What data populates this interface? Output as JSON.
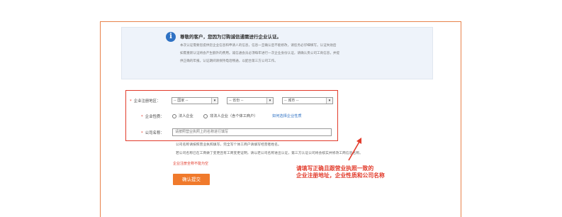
{
  "notice": {
    "title": "尊敬的客户，您因为订购诚信通需进行企业认证。",
    "lines": [
      "本次认证需要您提供您企业信息和申请人的信息，信息一旦确认后不能修改，请您务必仔细填写。认证失败后",
      "如需重新认证将会产生额外的费用。诚信通会员必须每年进行一次企业身份认证，请确认贵公司工商信息，并提",
      "供正确的年报。认证期间请保持电话畅通，以配合第三方公司工作。"
    ]
  },
  "form": {
    "address_label": "企业注册地区：",
    "country_select": "-- 国家 --",
    "province_select": "-- 省份 --",
    "city_select": "-- 城市 --",
    "nature_label": "企业性质：",
    "radio_legal": "法人企业",
    "radio_nonlegal": "非法人企业（含个体工商户）",
    "nature_link": "如何选择企业性质",
    "name_label": "公司名称：",
    "name_placeholder": "请按照营业执照上的名称进行填写",
    "help_1": "公司名称请按照营业执照填写，完全写个体工商户请填写经营者姓名。",
    "help_2": "若公司名称已在工商做了变更且有工商变更证明，请以老公司名称进出认证，第三方认证公司将会核实并修改工商信息名称。",
    "error": "企业注册全称不能为空",
    "submit": "确认提交"
  },
  "callout": {
    "line1": "请填写正确且跟营业执照一致的",
    "line2": "企业注册地址，企业性质和公司名称"
  },
  "colors": {
    "frame": "#e8824a",
    "highlight": "#e23b2b",
    "button": "#f07a2c",
    "info": "#2f72c4"
  }
}
